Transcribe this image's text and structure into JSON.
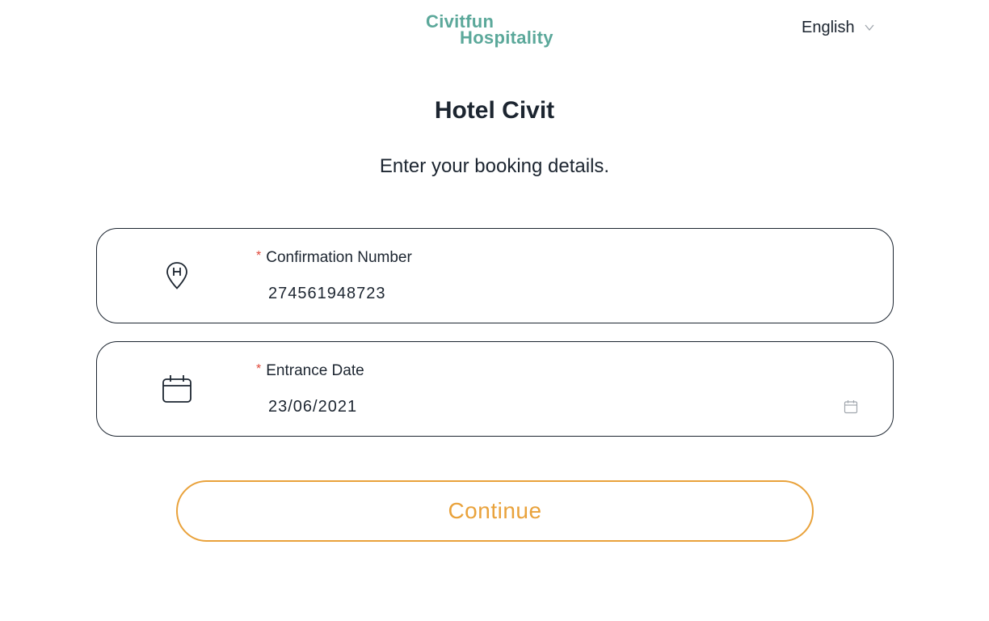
{
  "brand": {
    "logo_line1": "Civitfun",
    "logo_line2": "Hospitality",
    "color": "#5ba89a"
  },
  "header": {
    "language": "English",
    "chevron_icon": "chevron-down-icon"
  },
  "main": {
    "title": "Hotel Civit",
    "subtitle": "Enter your booking details."
  },
  "form": {
    "required_marker": "*",
    "confirmation": {
      "label": "Confirmation Number",
      "value": "274561948723",
      "icon": "hotel-location-pin-icon"
    },
    "entrance_date": {
      "label": "Entrance Date",
      "value": "23/06/2021",
      "icon": "calendar-icon",
      "picker_icon": "calendar-picker-icon"
    },
    "continue_label": "Continue"
  },
  "colors": {
    "accent": "#e9a23b",
    "text": "#1c2530",
    "required": "#e0483a",
    "muted_icon": "#a0a6ad"
  }
}
